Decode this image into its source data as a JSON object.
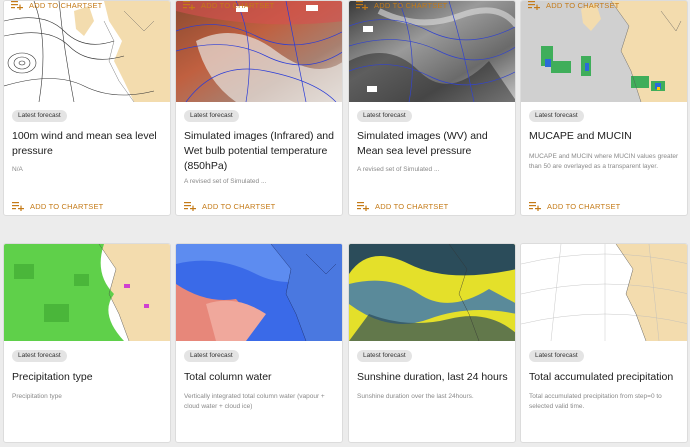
{
  "tag_label": "Latest forecast",
  "add_label": "ADD TO CHARTSET",
  "cards": [
    {
      "title": "100m wind and mean sea level pressure",
      "desc": "N/A"
    },
    {
      "title": "Simulated images (Infrared) and Wet bulb potential temperature (850hPa)",
      "desc": "A revised set of Simulated ..."
    },
    {
      "title": "Simulated images (WV) and Mean sea level pressure",
      "desc": "A revised set of Simulated ..."
    },
    {
      "title": "MUCAPE and MUCIN",
      "desc": "MUCAPE and MUCIN where MUCIN values greater than 50 are overlayed as a transparent layer."
    },
    {
      "title": "Precipitation type",
      "desc": "Precipitation type"
    },
    {
      "title": "Total column water",
      "desc": "Vertically integrated total column water (vapour + cloud water + cloud ice)"
    },
    {
      "title": "Sunshine duration, last 24 hours",
      "desc": "Sunshine duration over the last 24hours."
    },
    {
      "title": "Total accumulated precipitation",
      "desc": "Total accumulated precipitation from step=0 to selected valid time."
    }
  ],
  "colors": {
    "accent": "#c47a17",
    "land": "#f3dcae"
  }
}
